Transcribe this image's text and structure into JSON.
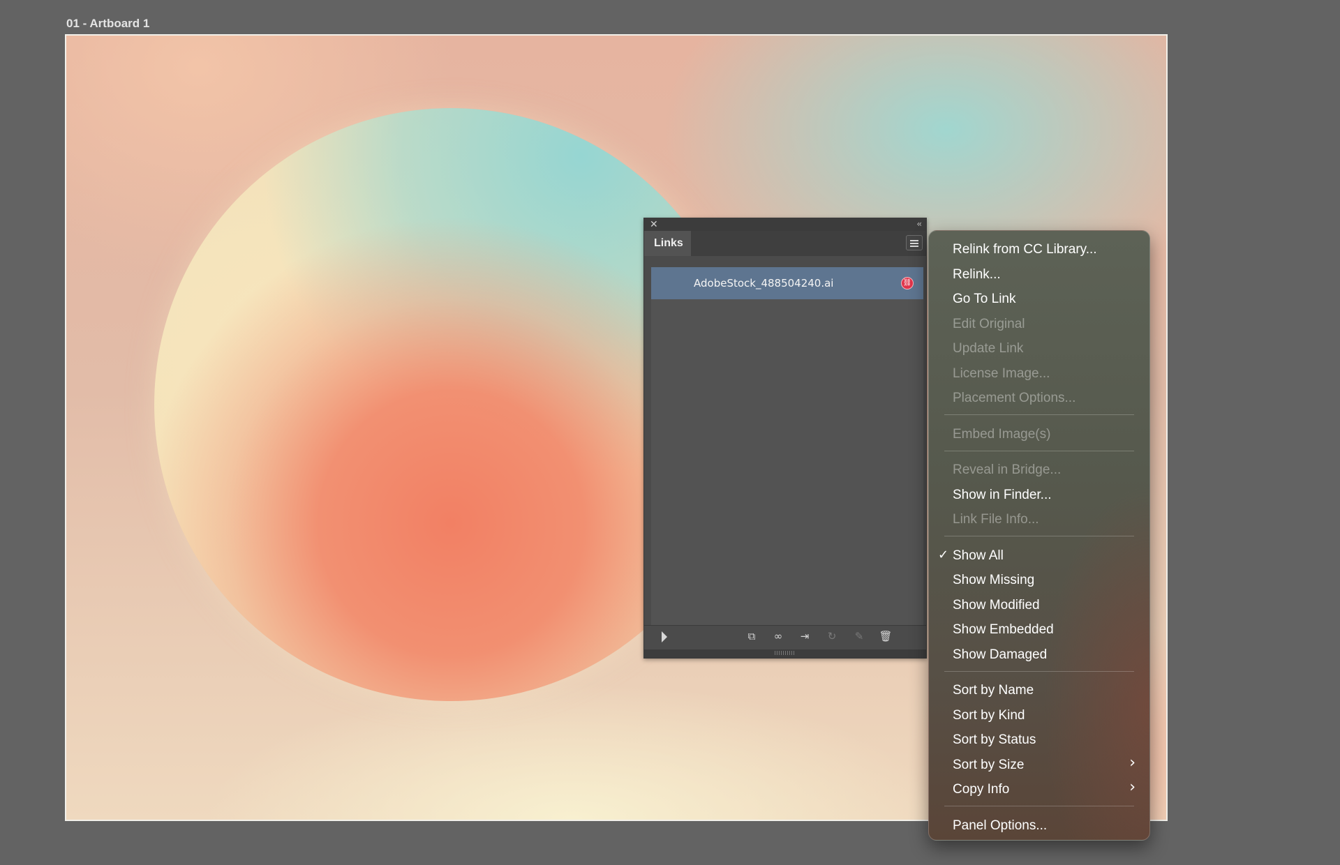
{
  "artboard": {
    "label": "01 - Artboard 1"
  },
  "links_panel": {
    "close_icon": "close-icon",
    "collapse_icon": "double-chevron-left-icon",
    "tab_label": "Links",
    "menu_icon": "hamburger-menu-icon",
    "items": [
      {
        "name": "AdobeStock_488504240.ai",
        "status_icon": "missing-link-icon",
        "status_color": "#e0344a"
      }
    ],
    "footer_icons": [
      "show-link-info-icon",
      "relink-from-cc-library-icon",
      "relink-icon",
      "go-to-link-icon",
      "update-link-icon",
      "edit-original-icon",
      "delete-icon"
    ]
  },
  "context_menu": {
    "items": [
      {
        "label": "Relink from CC Library...",
        "enabled": true
      },
      {
        "label": "Relink...",
        "enabled": true
      },
      {
        "label": "Go To Link",
        "enabled": true
      },
      {
        "label": "Edit Original",
        "enabled": false
      },
      {
        "label": "Update Link",
        "enabled": false
      },
      {
        "label": "License Image...",
        "enabled": false
      },
      {
        "label": "Placement Options...",
        "enabled": false
      },
      {
        "label": "Embed Image(s)",
        "enabled": false
      },
      {
        "label": "Reveal in Bridge...",
        "enabled": false
      },
      {
        "label": "Show in Finder...",
        "enabled": true
      },
      {
        "label": "Link File Info...",
        "enabled": false
      },
      {
        "label": "Show All",
        "enabled": true,
        "checked": true
      },
      {
        "label": "Show Missing",
        "enabled": true
      },
      {
        "label": "Show Modified",
        "enabled": true
      },
      {
        "label": "Show Embedded",
        "enabled": true
      },
      {
        "label": "Show Damaged",
        "enabled": true
      },
      {
        "label": "Sort by Name",
        "enabled": true
      },
      {
        "label": "Sort by Kind",
        "enabled": true
      },
      {
        "label": "Sort by Status",
        "enabled": true
      },
      {
        "label": "Sort by Size",
        "enabled": true,
        "submenu": true
      },
      {
        "label": "Copy Info",
        "enabled": true,
        "submenu": true
      },
      {
        "label": "Panel Options...",
        "enabled": true
      }
    ],
    "check_mark": "✓",
    "submenu_arrow": "›"
  }
}
